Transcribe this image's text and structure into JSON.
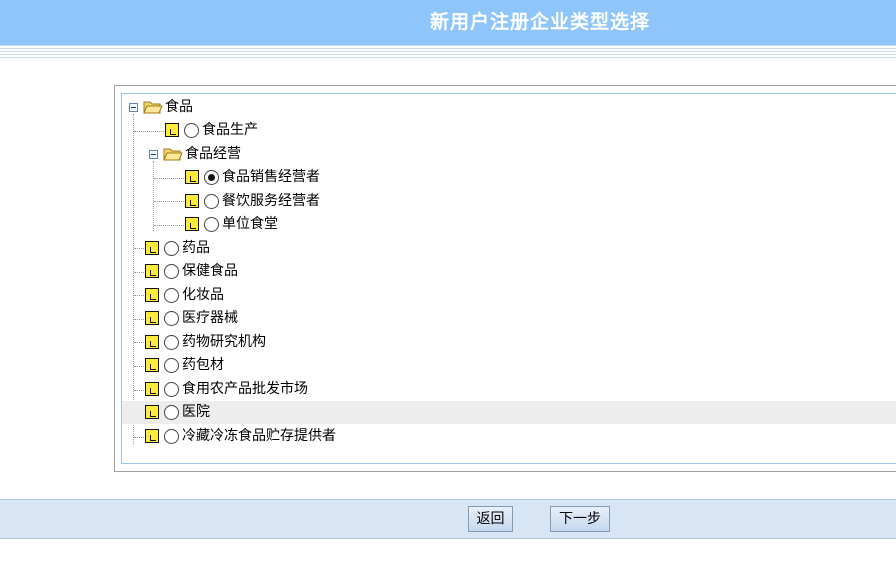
{
  "header": {
    "title": "新用户注册企业类型选择"
  },
  "tree": {
    "root": {
      "label": "食品",
      "children": {
        "food_production": {
          "label": "食品生产",
          "selected": false
        },
        "food_business": {
          "label": "食品经营",
          "children": {
            "food_sales": {
              "label": "食品销售经营者",
              "selected": true
            },
            "catering": {
              "label": "餐饮服务经营者",
              "selected": false
            },
            "canteen": {
              "label": "单位食堂",
              "selected": false
            }
          }
        }
      }
    },
    "items": [
      {
        "label": "药品",
        "selected": false
      },
      {
        "label": "保健食品",
        "selected": false
      },
      {
        "label": "化妆品",
        "selected": false
      },
      {
        "label": "医疗器械",
        "selected": false
      },
      {
        "label": "药物研究机构",
        "selected": false
      },
      {
        "label": "药包材",
        "selected": false
      },
      {
        "label": "食用农产品批发市场",
        "selected": false
      },
      {
        "label": "医院",
        "selected": false,
        "highlighted": true
      },
      {
        "label": "冷藏冷冻食品贮存提供者",
        "selected": false
      }
    ]
  },
  "footer": {
    "back_label": "返回",
    "next_label": "下一步"
  }
}
